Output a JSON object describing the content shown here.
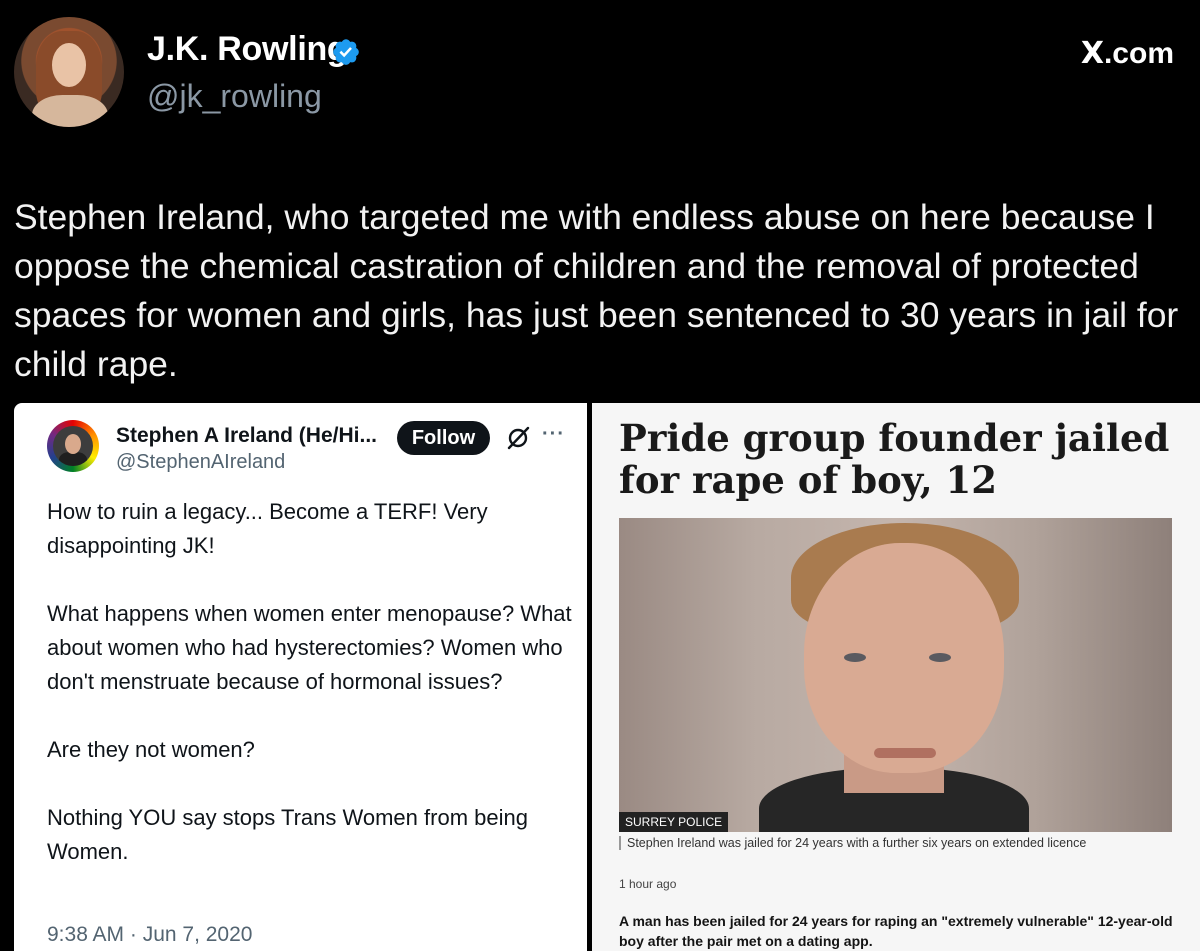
{
  "author": {
    "display_name": "J.K. Rowling",
    "handle": "@jk_rowling",
    "verified": true
  },
  "source": {
    "label": ".com",
    "logo": "X"
  },
  "tweet": {
    "text": "Stephen Ireland, who targeted me with endless abuse on here because I oppose the chemical castration of children and the removal of protected spaces for women and girls, has just been sentenced to 30 years in jail for child rape."
  },
  "embedded_tweet": {
    "display_name": "Stephen A Ireland (He/Hi...",
    "handle": "@StephenAIreland",
    "follow_label": "Follow",
    "more_label": "···",
    "body": "How to ruin a legacy... Become a TERF! Very disappointing JK!\n\nWhat happens when women enter menopause? What about women who had hysterectomies? Women who don't menstruate because of hormonal issues?\n\nAre they not women?\n\nNothing YOU say stops Trans Women from being Women.",
    "timestamp": "9:38 AM · Jun 7, 2020"
  },
  "news_article": {
    "headline": "Pride group founder jailed for rape of boy, 12",
    "photo_credit": "SURREY POLICE",
    "caption": "Stephen Ireland was jailed for 24 years with a further six years on extended licence",
    "published": "1 hour ago",
    "lede": "A man has been jailed for 24 years for raping an \"extremely vulnerable\" 12-year-old boy after the pair met on a dating app."
  },
  "colors": {
    "background": "#000000",
    "verified_blue": "#1d9bf0",
    "handle_gray": "#8b98a5"
  }
}
